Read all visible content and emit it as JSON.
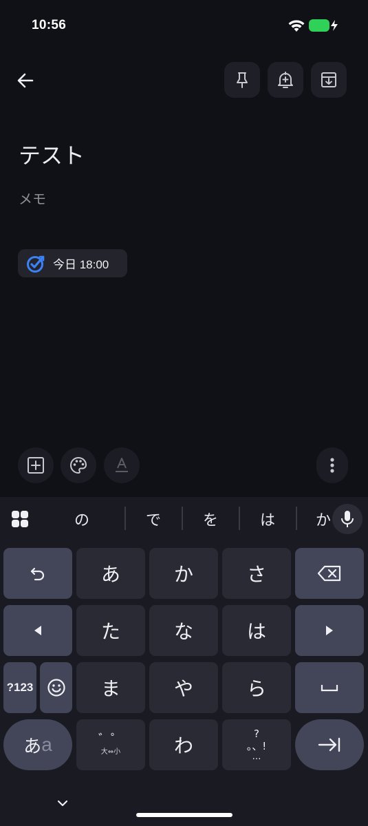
{
  "status": {
    "time": "10:56"
  },
  "header": {
    "actions": [
      "pin-icon",
      "add-reminder-icon",
      "archive-icon"
    ]
  },
  "note": {
    "title": "テスト",
    "body_placeholder": "メモ",
    "reminder_chip": "今日 18:00"
  },
  "bottom_toolbar": {
    "actions": [
      "add-box-icon",
      "palette-icon",
      "text-format-icon",
      "more-vert-icon"
    ]
  },
  "keyboard": {
    "suggestions": [
      "の",
      "で",
      "を",
      "は",
      "か"
    ],
    "row1": {
      "k1": "あ",
      "k2": "か",
      "k3": "さ"
    },
    "row2": {
      "k1": "た",
      "k2": "な",
      "k3": "は"
    },
    "row3": {
      "mode": "?123",
      "k1": "ま",
      "k2": "や",
      "k3": "ら"
    },
    "row4": {
      "lang_main": "あ",
      "lang_sub": "a",
      "dakuten_top": "゛゜",
      "dakuten_bottom": "大⇔小",
      "k_wa": "わ",
      "punct_top": "?",
      "punct_mid": "。、!",
      "punct_bottom": "…"
    }
  },
  "colors": {
    "background": "#101017",
    "keyboard_bg": "#1a1a23",
    "key": "#2a2a34",
    "func_key": "#434659",
    "accent": "#3b82f6",
    "battery": "#30d158"
  }
}
